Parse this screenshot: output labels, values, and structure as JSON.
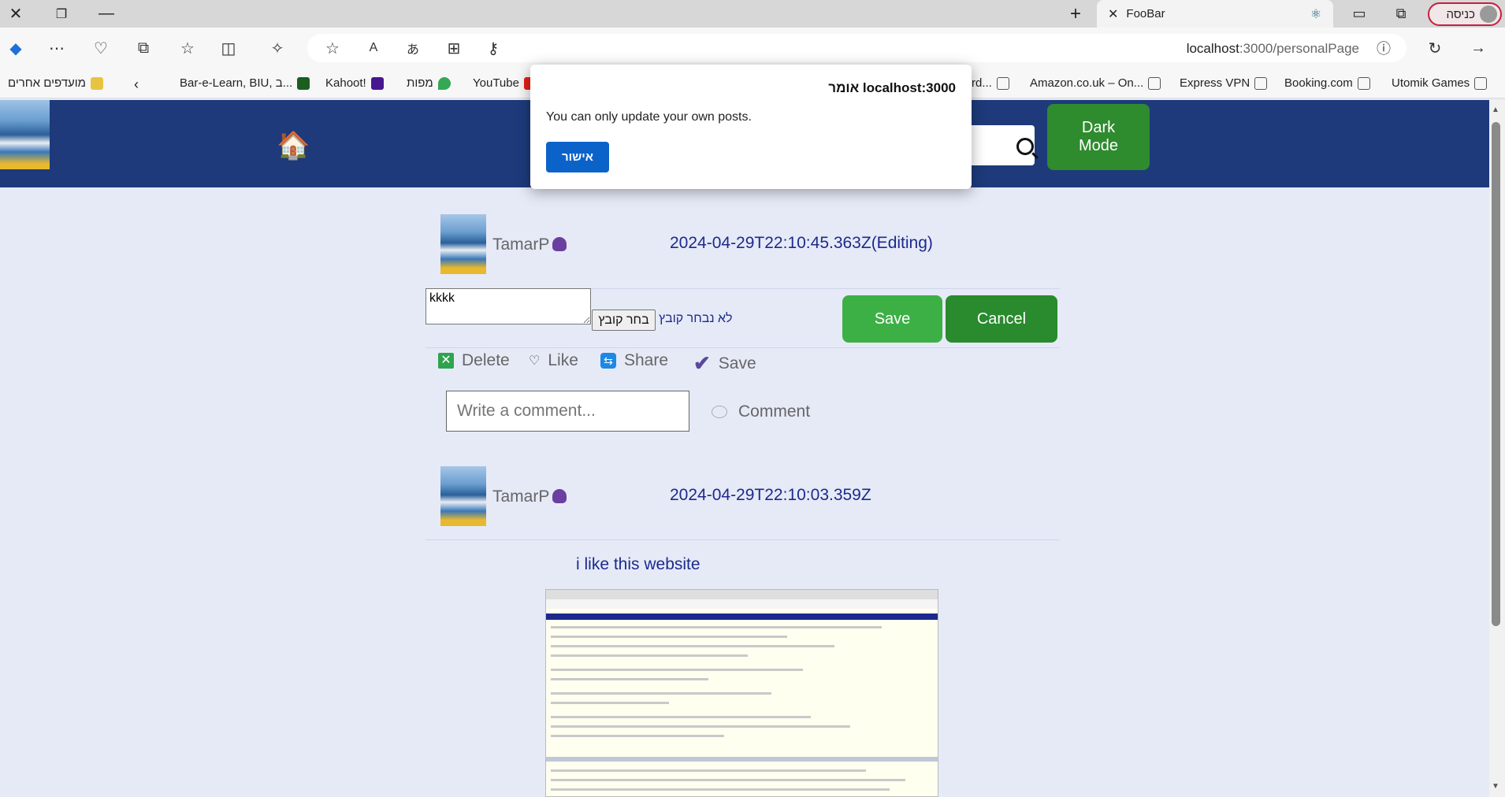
{
  "browser": {
    "tab_title": "FooBar",
    "profile_label": "כניסה",
    "url_host": "localhost",
    "url_rest": ":3000/personalPage",
    "bookmarks": [
      "מועדפים אחרים",
      "Bar-e-Learn, BIU, ב...",
      "Kahoot!",
      "מפות",
      "YouTube",
      "rd...",
      "Amazon.co.uk – On...",
      "Express VPN",
      "Booking.com",
      "Utomik Games"
    ]
  },
  "header": {
    "dark_mode_label": "Dark\nMode"
  },
  "posts": [
    {
      "username": "TamarP",
      "timestamp": "2024-04-29T22:10:45.363Z(Editing)",
      "edit_text": "kkkk",
      "file_button": "בחר קובץ",
      "file_label": "לא נבחר קובץ",
      "save_label": "Save",
      "cancel_label": "Cancel",
      "actions": {
        "delete": "Delete",
        "like": "Like",
        "share": "Share",
        "save": "Save"
      },
      "comment_placeholder": "Write a comment...",
      "comment_label": "Comment"
    },
    {
      "username": "TamarP",
      "timestamp": "2024-04-29T22:10:03.359Z",
      "text": "i like this website"
    }
  ],
  "dialog": {
    "title": "localhost:3000 אומר",
    "message": "You can only update your own posts.",
    "ok_label": "אישור"
  },
  "colors": {
    "header_bg": "#1e3a7b",
    "accent_green": "#3db045",
    "dialog_button": "#0b63c9"
  }
}
